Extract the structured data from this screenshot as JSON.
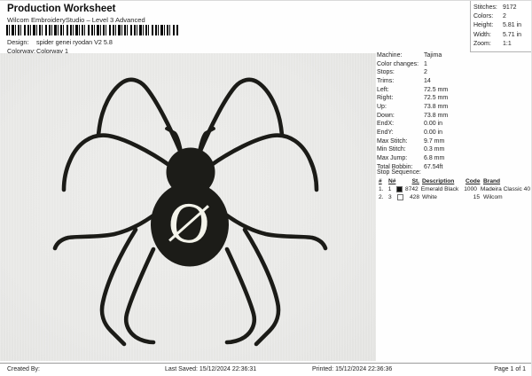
{
  "header": {
    "title": "Production Worksheet",
    "subtitle": "Wilcom EmbroideryStudio – Level 3 Advanced",
    "design_label": "Design:",
    "design_value": "spider genei ryodan V2 5.8",
    "colorway_label": "Colorway:",
    "colorway_value": "Colorway 1"
  },
  "summary": {
    "rows": [
      {
        "label": "Stitches:",
        "value": "9172"
      },
      {
        "label": "Colors:",
        "value": "2"
      },
      {
        "label": "Height:",
        "value": "5.81 in"
      },
      {
        "label": "Width:",
        "value": "5.71 in"
      },
      {
        "label": "Zoom:",
        "value": "1:1"
      }
    ]
  },
  "details": {
    "rows": [
      {
        "label": "Machine:",
        "value": "Tajima"
      },
      {
        "label": "Color changes:",
        "value": "1"
      },
      {
        "label": "Stops:",
        "value": "2"
      },
      {
        "label": "Trims:",
        "value": "14"
      },
      {
        "label": "Left:",
        "value": "72.5 mm"
      },
      {
        "label": "Right:",
        "value": "72.5 mm"
      },
      {
        "label": "Up:",
        "value": "73.8 mm"
      },
      {
        "label": "Down:",
        "value": "73.8 mm"
      },
      {
        "label": "EndX:",
        "value": "0.00 in"
      },
      {
        "label": "EndY:",
        "value": "0.00 in"
      },
      {
        "label": "Max Stitch:",
        "value": "9.7 mm"
      },
      {
        "label": "Min Stitch:",
        "value": "0.3 mm"
      },
      {
        "label": "Max Jump:",
        "value": "6.8 mm"
      },
      {
        "label": "Total Bobbin:",
        "value": "67.54ft"
      }
    ]
  },
  "stop_sequence": {
    "title": "Stop Sequence:",
    "columns": {
      "num": "#",
      "n": "N#",
      "st": "St.",
      "description": "Description",
      "code": "Code",
      "brand": "Brand"
    },
    "rows": [
      {
        "num": "1.",
        "n": "1",
        "swatch_hex": "#111110",
        "swatch_name": "emerald-black",
        "st": "8742",
        "description": "Emerald Black",
        "code": "1000",
        "brand": "Madeira Classic 40"
      },
      {
        "num": "2.",
        "n": "3",
        "swatch_hex": "#ffffff",
        "swatch_name": "white",
        "st": "428",
        "description": "White",
        "code": "15",
        "brand": "Wilcom"
      }
    ]
  },
  "canvas": {
    "design_name": "spider genei ryodan V2 5.8",
    "monogram": "Ø",
    "background_hex": "#e9e9e7",
    "thread_hex": "#1c1c18",
    "monogram_hex": "#f3f3ea"
  },
  "footer": {
    "created_by": "Created By:",
    "last_saved": "Last Saved: 15/12/2024 22:36:31",
    "printed": "Printed: 15/12/2024 22:36:36",
    "page": "Page 1 of 1"
  }
}
